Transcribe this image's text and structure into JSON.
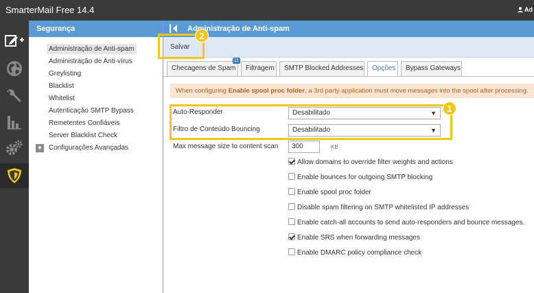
{
  "app": {
    "title": "SmarterMail Free 14.4",
    "user": "Ad"
  },
  "rail": [
    {
      "name": "compose-icon"
    },
    {
      "name": "globe-icon"
    },
    {
      "name": "wrench-icon"
    },
    {
      "name": "bar-chart-icon"
    },
    {
      "name": "gears-icon"
    },
    {
      "name": "shield-icon",
      "active": true
    }
  ],
  "sidebar": {
    "header": "Segurança",
    "items": [
      {
        "label": "Administração de Anti-spam"
      },
      {
        "label": "Administração de Anti-vírus"
      },
      {
        "label": "Greylisting"
      },
      {
        "label": "Blacklist"
      },
      {
        "label": "Whitelist"
      },
      {
        "label": "Autenticação SMTP Bypass"
      },
      {
        "label": "Remetentes Confiáveis"
      },
      {
        "label": "Server Blacklist Check"
      },
      {
        "label": "Configurações Avançadas"
      }
    ]
  },
  "main": {
    "title": "Administração de Anti-spam",
    "save_label": "Salvar",
    "tabs": [
      {
        "label": "Checagens de Spam",
        "badge": "11"
      },
      {
        "label": "Filtragem"
      },
      {
        "label": "SMTP Blocked Addresses"
      },
      {
        "label": "Opções"
      },
      {
        "label": "Bypass Gateways"
      }
    ],
    "alert": {
      "pre": "When configuring ",
      "bold": "Enable spool proc folder",
      "post": ", a 3rd party application must move messages into the spool after processing."
    },
    "fields": {
      "auto_responder_label": "Auto-Responder",
      "auto_responder_value": "Desabilitado",
      "bouncing_label": "Filtro de Conteúdo Bouncing",
      "bouncing_value": "Desabilitado",
      "max_size_label": "Max message size to content scan",
      "max_size_value": "300",
      "max_size_unit": "KB"
    },
    "checkboxes": [
      {
        "label": "Allow domains to override filter weights and actions",
        "checked": true
      },
      {
        "label": "Enable bounces for outgoing SMTP blocking",
        "checked": false
      },
      {
        "label": "Enable spool proc folder",
        "checked": false
      },
      {
        "label": "Disable spam filtering on SMTP whitelisted IP addresses",
        "checked": false
      },
      {
        "label": "Enable catch-all accounts to send auto-responders and bounce messages.",
        "checked": false
      },
      {
        "label": "Enable SRS when forwarding messages",
        "checked": true
      },
      {
        "label": "Enable DMARC policy compliance check",
        "checked": false
      }
    ]
  },
  "annotations": {
    "badge_1": "1",
    "badge_2": "2",
    "color": "#f5c518"
  },
  "colors": {
    "header_blue": "#5b9bd5",
    "dark_bg": "#3a3a3a",
    "toolbar_bg": "#dfe9f5",
    "alert_bg": "#fbe3d3",
    "alert_text": "#b5651d"
  }
}
